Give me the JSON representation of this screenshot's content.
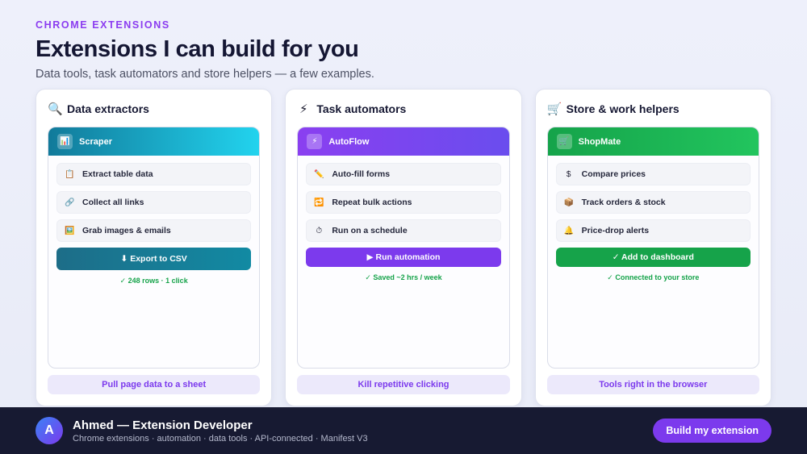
{
  "header": {
    "eyebrow": "CHROME EXTENSIONS",
    "title": "Extensions I can build for you",
    "subtitle": "Data tools, task automators and store helpers — a few examples."
  },
  "cards": [
    {
      "icon": "🔍",
      "title": "Data extractors",
      "window": {
        "badge": "📊",
        "name": "Scraper"
      },
      "items": [
        {
          "icon": "📋",
          "label": "Extract table data"
        },
        {
          "icon": "🔗",
          "label": "Collect all links"
        },
        {
          "icon": "🖼️",
          "label": "Grab images & emails"
        }
      ],
      "action": "⬇ Export to CSV",
      "status": "✓ 248 rows · 1 click",
      "footer": "Pull page data to a sheet"
    },
    {
      "icon": "⚡",
      "title": "Task automators",
      "window": {
        "badge": "⚡",
        "name": "AutoFlow"
      },
      "items": [
        {
          "icon": "✏️",
          "label": "Auto-fill forms"
        },
        {
          "icon": "🔁",
          "label": "Repeat bulk actions"
        },
        {
          "icon": "⏱",
          "label": "Run on a schedule"
        }
      ],
      "action": "▶ Run automation",
      "status": "✓ Saved ~2 hrs / week",
      "footer": "Kill repetitive clicking"
    },
    {
      "icon": "🛒",
      "title": "Store & work helpers",
      "window": {
        "badge": "🛒",
        "name": "ShopMate"
      },
      "items": [
        {
          "icon": "$",
          "label": "Compare prices"
        },
        {
          "icon": "📦",
          "label": "Track orders & stock"
        },
        {
          "icon": "🔔",
          "label": "Price-drop alerts"
        }
      ],
      "action": "✓ Add to dashboard",
      "status": "✓ Connected to your store",
      "footer": "Tools right in the browser"
    }
  ],
  "profile": {
    "initial": "A",
    "name": "Ahmed — Extension Developer",
    "tags": "Chrome extensions · automation · data tools · API-connected · Manifest V3",
    "cta": "Build my extension"
  },
  "colors": {
    "accent": "#7c3aed",
    "teal": "#117a9a",
    "green": "#16a34a",
    "footer_bg": "#171a32"
  }
}
